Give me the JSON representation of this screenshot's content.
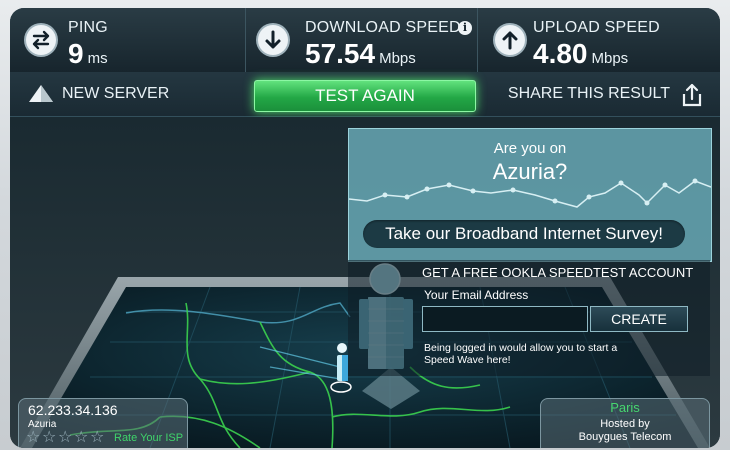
{
  "colors": {
    "accent_green": "#2fbf52",
    "panel_teal": "#67a8b5",
    "map_dark": "#0c161d",
    "route_green": "#3bd24e"
  },
  "stats": {
    "ping": {
      "label": "PING",
      "value": "9",
      "unit": "ms",
      "icon": "ping-arrows-icon"
    },
    "download": {
      "label": "DOWNLOAD SPEED",
      "value": "57.54",
      "unit": "Mbps",
      "icon": "download-arrow-icon",
      "info_icon": "info-icon"
    },
    "upload": {
      "label": "UPLOAD SPEED",
      "value": "4.80",
      "unit": "Mbps",
      "icon": "upload-arrow-icon"
    }
  },
  "actions": {
    "new_server": "NEW SERVER",
    "test_again": "TEST AGAIN",
    "share": "SHARE THIS RESULT"
  },
  "survey": {
    "question_line1": "Are you on",
    "question_line2": "Azuria?",
    "button": "Take our Broadband Internet Survey!"
  },
  "account": {
    "header": "GET A FREE OOKLA SPEEDTEST ACCOUNT",
    "email_label": "Your Email Address",
    "email_value": "",
    "email_placeholder": "",
    "create_button": "CREATE",
    "note": "Being logged in would allow you to start a Speed Wave here!"
  },
  "isp": {
    "ip": "62.233.34.136",
    "name": "Azuria",
    "rating_stars": 5,
    "rating_filled": 0,
    "rate_link": "Rate Your ISP"
  },
  "host": {
    "city": "Paris",
    "hosted_by": "Hosted by",
    "host_name": "Bouygues Telecom"
  }
}
